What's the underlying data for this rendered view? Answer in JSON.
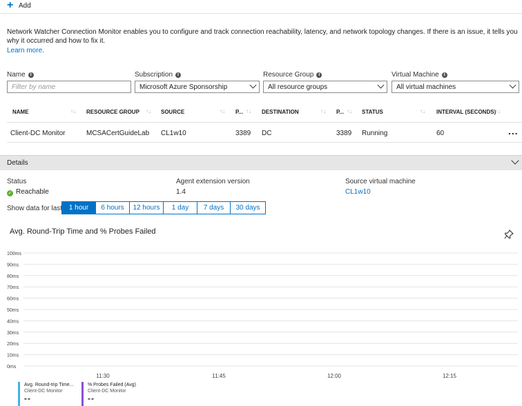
{
  "toolbar": {
    "add_label": "Add"
  },
  "description": {
    "text": "Network Watcher Connection Monitor enables you to configure and track connection reachability, latency, and network topology changes. If there is an issue, it tells you why it occurred and how to fix it.",
    "learn_more": "Learn more."
  },
  "filters": {
    "name_label": "Name",
    "name_placeholder": "Filter by name",
    "subscription_label": "Subscription",
    "subscription_value": "Microsoft Azure Sponsorship",
    "resource_group_label": "Resource Group",
    "resource_group_value": "All resource groups",
    "vm_label": "Virtual Machine",
    "vm_value": "All virtual machines"
  },
  "table": {
    "columns": [
      "NAME",
      "RESOURCE GROUP",
      "SOURCE",
      "P...",
      "DESTINATION",
      "P...",
      "STATUS",
      "INTERVAL (SECONDS)"
    ],
    "rows": [
      [
        "Client-DC Monitor",
        "MCSACertGuideLab",
        "CL1w10",
        "3389",
        "DC",
        "3389",
        "Running",
        "60"
      ]
    ],
    "more_label": "..."
  },
  "details": {
    "title": "Details",
    "status_label": "Status",
    "status_value": "Reachable",
    "agent_label": "Agent extension version",
    "agent_value": "1.4",
    "source_vm_label": "Source virtual machine",
    "source_vm_value": "CL1w10",
    "show_data_label": "Show data for last",
    "ranges": [
      "1 hour",
      "6 hours",
      "12 hours",
      "1 day",
      "7 days",
      "30 days"
    ],
    "active_range": "1 hour"
  },
  "chart_data": {
    "type": "line",
    "title": "Avg. Round-Trip Time and % Probes Failed",
    "y_ticks": [
      "100ms",
      "90ms",
      "80ms",
      "70ms",
      "60ms",
      "50ms",
      "40ms",
      "30ms",
      "20ms",
      "10ms",
      "0ms"
    ],
    "x_ticks": [
      "11:30",
      "11:45",
      "12:00",
      "12:15"
    ],
    "ylim": [
      0,
      100
    ],
    "grid": true,
    "series": [
      {
        "name": "Avg. Round-trip Time...",
        "source": "Client-DC Monitor",
        "value": "--",
        "color": "#3fb3e6",
        "values": []
      },
      {
        "name": "% Probes Failed (Avg)",
        "source": "Client-DC Monitor",
        "value": "--",
        "color": "#8a4fd8",
        "values": []
      }
    ]
  },
  "colors": {
    "accent": "#0072c6",
    "ok": "#5bb12f",
    "header_bar": "#e6e6e6"
  },
  "icons": {
    "add": "plus-icon",
    "info": "info-icon",
    "pin": "pin-icon",
    "status": "check-circle-icon"
  }
}
